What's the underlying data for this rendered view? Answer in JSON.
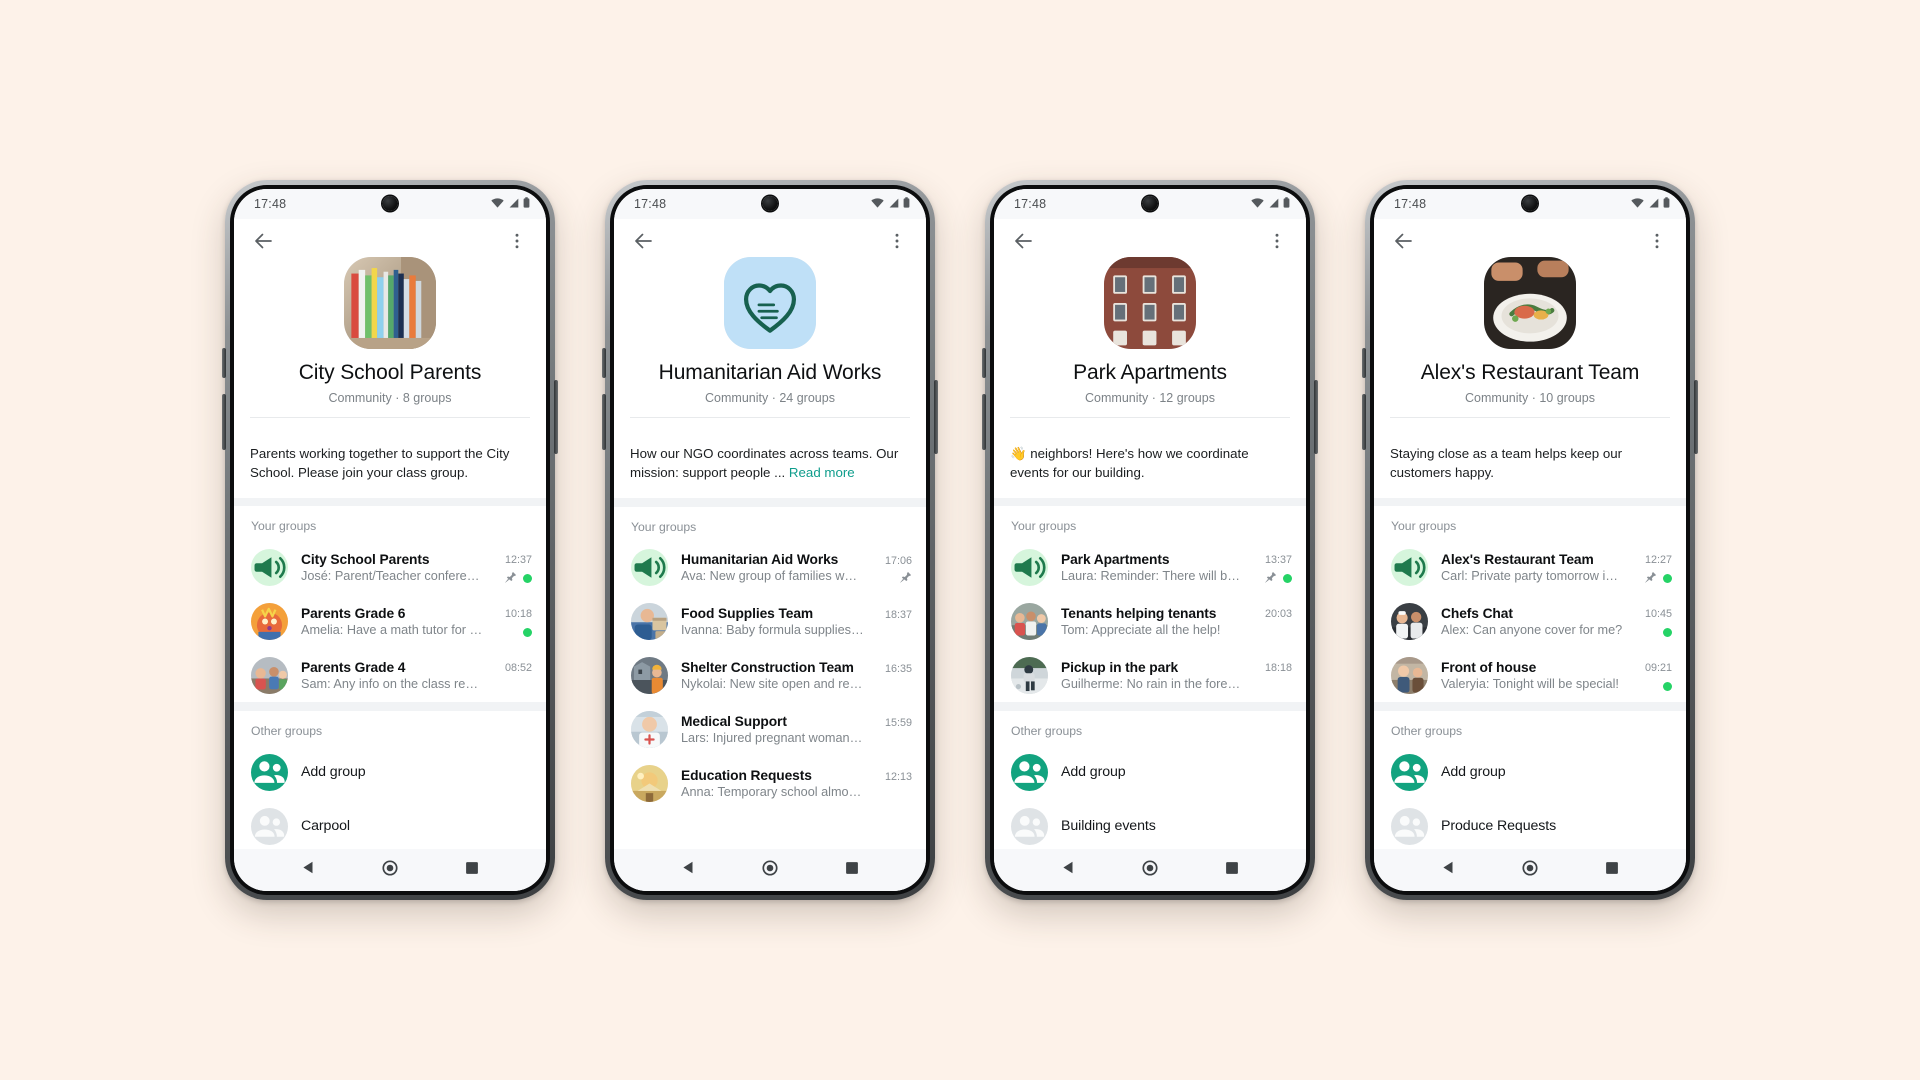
{
  "status_bar": {
    "time": "17:48",
    "icons": [
      "wifi-icon",
      "cellular-signal-icon",
      "battery-icon"
    ]
  },
  "app_bar": {
    "back": "back-arrow-icon",
    "menu": "overflow-menu-icon"
  },
  "colors": {
    "page_background": "#FDF2E9",
    "accent_green": "#12a37f",
    "link_green": "#0f9d8c",
    "unread_badge": "#25D366",
    "announce_bg": "#d6f5dc",
    "announce_fg": "#1f7a4d"
  },
  "labels": {
    "your_groups": "Your groups",
    "other_groups": "Other groups"
  },
  "phones": [
    {
      "title": "City School Parents",
      "subtitle": "Community · 8 groups",
      "avatar": "books-photo",
      "description": "Parents working together to support the City School. Please join your class group.",
      "read_more": "",
      "your_groups": [
        {
          "name": "City School Parents",
          "preview": "José: Parent/Teacher conferen…",
          "time": "12:37",
          "avatar": "announcement-megaphone-icon",
          "pinned": true,
          "unread": true
        },
        {
          "name": "Parents Grade 6",
          "preview": "Amelia: Have a math tutor for the…",
          "time": "10:18",
          "avatar": "kids-art-photo",
          "pinned": false,
          "unread": true
        },
        {
          "name": "Parents Grade 4",
          "preview": "Sam: Any info on the class recital?",
          "time": "08:52",
          "avatar": "classroom-photo",
          "pinned": false,
          "unread": false
        }
      ],
      "other_groups": [
        {
          "name": "Add group",
          "avatar": "add-group-icon",
          "type": "action"
        },
        {
          "name": "Carpool",
          "avatar": "placeholder-group-icon",
          "type": "group"
        }
      ]
    },
    {
      "title": "Humanitarian Aid Works",
      "subtitle": "Community · 24 groups",
      "avatar": "heart-hands-logo",
      "description": "How our NGO coordinates across teams. Our mission: support people ...",
      "read_more": "Read more",
      "your_groups": [
        {
          "name": "Humanitarian Aid Works",
          "preview": "Ava: New group of families waitin…",
          "time": "17:06",
          "avatar": "announcement-megaphone-icon",
          "pinned": true,
          "unread": false
        },
        {
          "name": "Food Supplies Team",
          "preview": "Ivanna: Baby formula supplies running …",
          "time": "18:37",
          "avatar": "food-supplies-photo",
          "pinned": false,
          "unread": false
        },
        {
          "name": "Shelter Construction Team",
          "preview": "Nykolai: New site open and ready for …",
          "time": "16:35",
          "avatar": "construction-photo",
          "pinned": false,
          "unread": false
        },
        {
          "name": "Medical Support",
          "preview": "Lars: Injured pregnant woman in need…",
          "time": "15:59",
          "avatar": "medical-photo",
          "pinned": false,
          "unread": false
        },
        {
          "name": "Education Requests",
          "preview": "Anna: Temporary school almost comp…",
          "time": "12:13",
          "avatar": "education-photo",
          "pinned": false,
          "unread": false
        }
      ],
      "other_groups": []
    },
    {
      "title": "Park Apartments",
      "subtitle": "Community · 12 groups",
      "avatar": "apartment-building-photo",
      "description": "👋 neighbors! Here's how we coordinate events for our building.",
      "read_more": "",
      "your_groups": [
        {
          "name": "Park Apartments",
          "preview": "Laura: Reminder: There will be…",
          "time": "13:37",
          "avatar": "announcement-megaphone-icon",
          "pinned": true,
          "unread": true
        },
        {
          "name": "Tenants helping tenants",
          "preview": "Tom: Appreciate all the help!",
          "time": "20:03",
          "avatar": "tenants-photo",
          "pinned": false,
          "unread": false
        },
        {
          "name": "Pickup in the park",
          "preview": "Guilherme: No rain in the forecast!",
          "time": "18:18",
          "avatar": "park-photo",
          "pinned": false,
          "unread": false
        }
      ],
      "other_groups": [
        {
          "name": "Add group",
          "avatar": "add-group-icon",
          "type": "action"
        },
        {
          "name": "Building events",
          "avatar": "placeholder-group-icon",
          "type": "group"
        }
      ]
    },
    {
      "title": "Alex's Restaurant Team",
      "subtitle": "Community · 10 groups",
      "avatar": "restaurant-dish-photo",
      "description": "Staying close as a team helps keep our customers happy.",
      "read_more": "",
      "your_groups": [
        {
          "name": "Alex's Restaurant Team",
          "preview": "Carl: Private party tomorrow in…",
          "time": "12:27",
          "avatar": "announcement-megaphone-icon",
          "pinned": true,
          "unread": true
        },
        {
          "name": "Chefs Chat",
          "preview": "Alex: Can anyone cover for me?",
          "time": "10:45",
          "avatar": "chefs-photo",
          "pinned": false,
          "unread": true
        },
        {
          "name": "Front of house",
          "preview": "Valeryia: Tonight will be special!",
          "time": "09:21",
          "avatar": "front-house-photo",
          "pinned": false,
          "unread": true
        }
      ],
      "other_groups": [
        {
          "name": "Add group",
          "avatar": "add-group-icon",
          "type": "action"
        },
        {
          "name": "Produce Requests",
          "avatar": "placeholder-group-icon",
          "type": "group"
        }
      ]
    }
  ],
  "nav_bar": {
    "back": "nav-back-triangle-icon",
    "home": "nav-home-circle-icon",
    "recents": "nav-recents-square-icon"
  }
}
